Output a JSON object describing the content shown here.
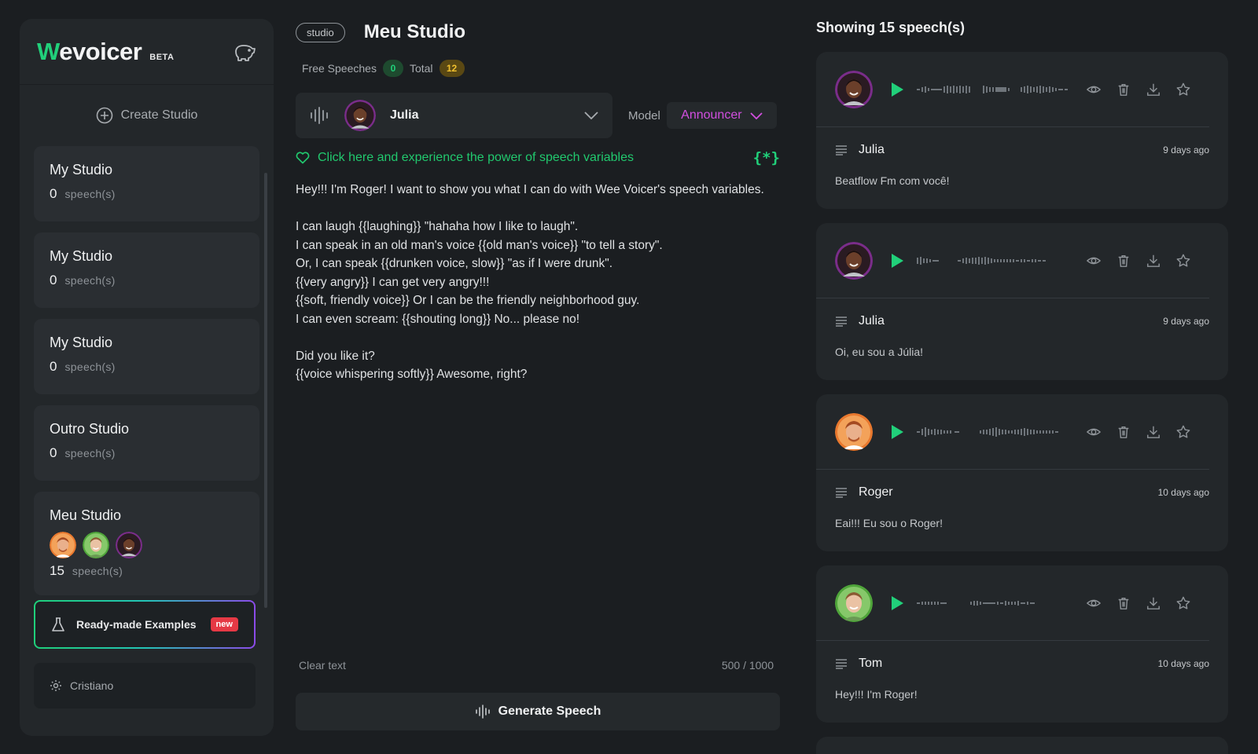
{
  "sidebar": {
    "logo_w": "W",
    "logo_rest": "evoicer",
    "beta": "BETA",
    "create_studio": "Create Studio",
    "studios": [
      {
        "name": "My Studio",
        "count": "0",
        "unit": "speech(s)"
      },
      {
        "name": "My Studio",
        "count": "0",
        "unit": "speech(s)"
      },
      {
        "name": "My Studio",
        "count": "0",
        "unit": "speech(s)"
      },
      {
        "name": "Outro Studio",
        "count": "0",
        "unit": "speech(s)"
      },
      {
        "name": "Meu Studio",
        "count": "15",
        "unit": "speech(s)"
      }
    ],
    "examples_label": "Ready-made Examples",
    "new_badge": "new",
    "user_name": "Cristiano"
  },
  "editor": {
    "pill": "studio",
    "title": "Meu Studio",
    "free_label": "Free Speeches",
    "free_count": "0",
    "total_label": "Total",
    "total_count": "12",
    "voice_name": "Julia",
    "model_label": "Model",
    "model_value": "Announcer",
    "vars_link": "Click here and experience the power of speech variables",
    "vars_icon": "{*}",
    "text": "Hey!!! I'm Roger! I want to show you what I can do with Wee Voicer's speech variables.\n\nI can laugh {{laughing}} \"hahaha how I like to laugh\".\nI can speak in an old man's voice {{old man's voice}} \"to tell a story\".\nOr, I can speak {{drunken voice, slow}} \"as if I were drunk\".\n{{very angry}} I can get very angry!!!\n{{soft, friendly voice}} Or I can be the friendly neighborhood guy.\nI can even scream: {{shouting long}} No... please no!\n\nDid you like it?\n{{voice whispering softly}} Awesome, right?",
    "clear_text": "Clear text",
    "char_count": "500 / 1000",
    "generate": "Generate Speech"
  },
  "panel": {
    "title": "Showing 15 speech(s)",
    "speeches": [
      {
        "name": "Julia",
        "date": "9 days ago",
        "text": "Beatflow Fm com você!",
        "avatar": "julia"
      },
      {
        "name": "Julia",
        "date": "9 days ago",
        "text": "Oi, eu sou a Júlia!",
        "avatar": "julia"
      },
      {
        "name": "Roger",
        "date": "10 days ago",
        "text": "Eai!!! Eu sou o Roger!",
        "avatar": "roger"
      },
      {
        "name": "Tom",
        "date": "10 days ago",
        "text": "Hey!!! I'm Roger!",
        "avatar": "tom"
      }
    ]
  },
  "colors": {
    "accent_green": "#21d07a",
    "model_purple": "#d24fe0",
    "badge_red": "#e53945",
    "background": "#1b1e21",
    "card": "#23272a"
  },
  "icons": [
    "piggy-bank-icon",
    "plus-circle-icon",
    "flask-icon",
    "gear-icon",
    "waveform-icon",
    "chevron-down-icon",
    "heart-icon",
    "play-icon",
    "eye-icon",
    "trash-icon",
    "download-icon",
    "star-icon",
    "text-lines-icon"
  ]
}
